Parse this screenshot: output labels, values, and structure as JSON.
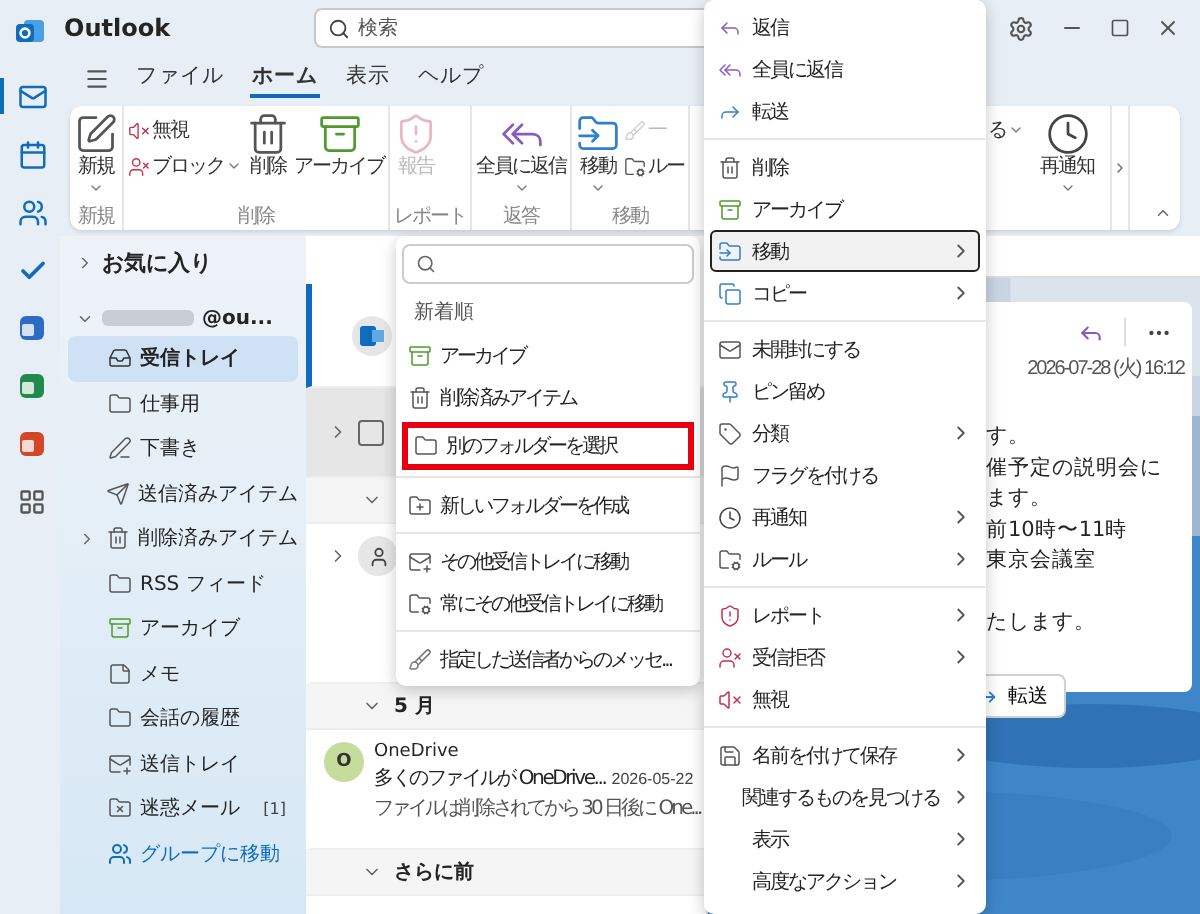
{
  "app": {
    "title": "Outlook"
  },
  "search": {
    "placeholder": "検索"
  },
  "rail": [
    {
      "kind": "mail",
      "selected": true
    },
    {
      "kind": "calendar",
      "selected": false
    },
    {
      "kind": "people",
      "selected": false
    },
    {
      "kind": "todo",
      "selected": false
    },
    {
      "kind": "app_blue",
      "selected": false
    },
    {
      "kind": "app_green",
      "selected": false
    },
    {
      "kind": "app_red",
      "selected": false
    },
    {
      "kind": "apps",
      "selected": false
    }
  ],
  "ribbon_tabs": [
    {
      "label": "ファイル",
      "selected": false
    },
    {
      "label": "ホーム",
      "selected": true
    },
    {
      "label": "表示",
      "selected": false
    },
    {
      "label": "ヘルプ",
      "selected": false
    }
  ],
  "ribbon": {
    "groups": [
      {
        "label": "新規",
        "commands": [
          {
            "kind": "new",
            "label": "新規",
            "dropdown": true,
            "disabled": false
          }
        ]
      },
      {
        "label": "削除",
        "commands": [
          {
            "stack": [
              {
                "kind": "ignore",
                "label": "無視",
                "dropdown": false,
                "disabled": false
              },
              {
                "kind": "block",
                "label": "ブロック",
                "dropdown": true,
                "disabled": false
              }
            ]
          },
          {
            "kind": "delete",
            "label": "削除",
            "dropdown": false,
            "disabled": false
          },
          {
            "kind": "archive",
            "label": "アーカイブ",
            "dropdown": false,
            "disabled": false
          }
        ]
      },
      {
        "label": "レポート",
        "commands": [
          {
            "kind": "report",
            "label": "報告",
            "dropdown": false,
            "disabled": true
          }
        ]
      },
      {
        "label": "返答",
        "commands": [
          {
            "kind": "reply_all",
            "label": "全員に返信",
            "dropdown": true,
            "disabled": false
          }
        ]
      },
      {
        "label": "移動",
        "commands": [
          {
            "kind": "move",
            "label": "移動",
            "dropdown": true,
            "disabled": false
          },
          {
            "stack": [
              {
                "kind": "sweep",
                "label": "一",
                "dropdown": false,
                "disabled": true
              },
              {
                "kind": "rule",
                "label": "ルー",
                "dropdown": false,
                "disabled": false
              }
            ]
          }
        ]
      }
    ],
    "right_commands": [
      {
        "stack": [
          {
            "label": "る",
            "dropdown": true,
            "disabled": false
          }
        ]
      },
      {
        "kind": "snooze",
        "label": "再通知",
        "dropdown": true,
        "disabled": false
      }
    ]
  },
  "folder_pane": {
    "favorites": {
      "label": "お気に入り",
      "expanded": false
    },
    "account": {
      "label": "@ou...",
      "expanded": true
    },
    "folders": [
      {
        "kind": "inbox",
        "label": "受信トレイ",
        "selected": true,
        "expandable": false
      },
      {
        "kind": "folder",
        "label": "仕事用",
        "selected": false,
        "expandable": false
      },
      {
        "kind": "drafts",
        "label": "下書き",
        "selected": false,
        "expandable": false
      },
      {
        "kind": "sent",
        "label": "送信済みアイテム",
        "selected": false,
        "expandable": false
      },
      {
        "kind": "delete",
        "label": "削除済みアイテム",
        "selected": false,
        "expandable": true
      },
      {
        "kind": "folder",
        "label": "RSS フィード",
        "selected": false,
        "expandable": false
      },
      {
        "kind": "archive",
        "label": "アーカイブ",
        "selected": false,
        "expandable": false
      },
      {
        "kind": "notes",
        "label": "メモ",
        "selected": false,
        "expandable": false
      },
      {
        "kind": "folder",
        "label": "会話の履歴",
        "selected": false,
        "expandable": false
      },
      {
        "kind": "outbox",
        "label": "送信トレイ",
        "selected": false,
        "expandable": false
      },
      {
        "kind": "junk",
        "label": "迷惑メール",
        "count": "[1]",
        "selected": false,
        "expandable": false
      }
    ],
    "group_link": "グループに移動"
  },
  "message_list": [
    {
      "kind": "message",
      "avatar": {
        "kind": "outlook"
      },
      "selected": true
    },
    {
      "kind": "thread",
      "avatar": {
        "kind": "checkbox",
        "checked": false
      },
      "hovered": true
    },
    {
      "kind": "header"
    },
    {
      "kind": "thread",
      "avatar": {
        "kind": "person"
      },
      "hovered": false
    },
    {
      "kind": "header",
      "label": "5 月"
    },
    {
      "kind": "message",
      "avatar": {
        "kind": "letter",
        "initial": "O"
      },
      "sender": "OneDrive",
      "subject": "多くのファイルが OneDrive...",
      "date": "2026-05-22",
      "preview": "ファイルは削除されてから 30 日後に One...",
      "selected": false
    },
    {
      "kind": "header",
      "label": "さらに前"
    }
  ],
  "reading_pane": {
    "date": "2026-07-28 (火) 16:12",
    "paragraphs": [
      [
        "す。",
        "催予定の説明会に",
        "ます。",
        "前10時〜11時",
        "東京会議室"
      ],
      [
        "たします。"
      ]
    ],
    "forward_button": "転送"
  },
  "move_submenu": {
    "heading": "新着順",
    "sections": [
      {
        "items": [
          {
            "kind": "archive",
            "label": "アーカイブ",
            "highlighted": false
          },
          {
            "kind": "delete",
            "label": "削除済みアイテム",
            "highlighted": false
          },
          {
            "kind": "folder",
            "label": "別のフォルダーを選択",
            "highlighted": true
          }
        ]
      },
      {
        "items": [
          {
            "kind": "new_folder",
            "label": "新しいフォルダーを作成",
            "highlighted": false
          }
        ]
      },
      {
        "items": [
          {
            "kind": "other_inbox",
            "label": "その他受信トレイに移動",
            "highlighted": false
          },
          {
            "kind": "rule",
            "label": "常にその他受信トレイに移動",
            "highlighted": false
          }
        ]
      },
      {
        "items": [
          {
            "kind": "sweep",
            "label": "指定した送信者からのメッセ...",
            "highlighted": false
          }
        ]
      }
    ]
  },
  "context_menu": {
    "sections": [
      {
        "items": [
          {
            "kind": "reply",
            "label": "返信",
            "submenu": false,
            "selected": false
          },
          {
            "kind": "reply_all",
            "label": "全員に返信",
            "submenu": false,
            "selected": false
          },
          {
            "kind": "forward",
            "label": "転送",
            "submenu": false,
            "selected": false
          }
        ]
      },
      {
        "items": [
          {
            "kind": "delete",
            "label": "削除",
            "submenu": false,
            "selected": false
          },
          {
            "kind": "archive",
            "label": "アーカイブ",
            "submenu": false,
            "selected": false
          },
          {
            "kind": "move",
            "label": "移動",
            "submenu": true,
            "selected": true
          },
          {
            "kind": "copy",
            "label": "コピー",
            "submenu": true,
            "selected": false
          }
        ]
      },
      {
        "items": [
          {
            "kind": "unread",
            "label": "未開封にする",
            "submenu": false,
            "selected": false
          },
          {
            "kind": "pin",
            "label": "ピン留め",
            "submenu": false,
            "selected": false
          },
          {
            "kind": "categorize",
            "label": "分類",
            "submenu": true,
            "selected": false
          },
          {
            "kind": "flag",
            "label": "フラグを付ける",
            "submenu": false,
            "selected": false
          },
          {
            "kind": "snooze",
            "label": "再通知",
            "submenu": true,
            "selected": false
          },
          {
            "kind": "rule",
            "label": "ルール",
            "submenu": true,
            "selected": false
          }
        ]
      },
      {
        "items": [
          {
            "kind": "report",
            "label": "レポート",
            "submenu": true,
            "selected": false
          },
          {
            "kind": "block",
            "label": "受信拒否",
            "submenu": true,
            "selected": false
          },
          {
            "kind": "ignore",
            "label": "無視",
            "submenu": false,
            "selected": false
          }
        ]
      },
      {
        "items": [
          {
            "kind": "save",
            "label": "名前を付けて保存",
            "submenu": true,
            "selected": false
          },
          {
            "kind": "none",
            "label": "関連するものを見つける",
            "submenu": true,
            "selected": false
          },
          {
            "kind": "none",
            "label": "表示",
            "submenu": true,
            "selected": false
          },
          {
            "kind": "none",
            "label": "高度なアクション",
            "submenu": true,
            "selected": false
          }
        ]
      }
    ]
  }
}
